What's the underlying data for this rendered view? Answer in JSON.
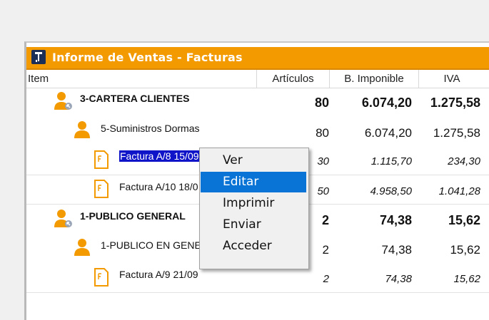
{
  "window": {
    "title": "Informe de Ventas - Facturas",
    "accent_color": "#f29a00",
    "icon": "document-pin-icon"
  },
  "columns": {
    "item": "Item",
    "articulos": "Artículos",
    "b_imponible": "B. Imponible",
    "iva": "IVA"
  },
  "rows": [
    {
      "level": 0,
      "icon": "user-group-icon",
      "label": "3-CARTERA CLIENTES",
      "articulos": "80",
      "b_imponible": "6.074,20",
      "iva": "1.275,58"
    },
    {
      "level": 1,
      "icon": "user-icon",
      "label": "5-Suministros Dormas",
      "articulos": "80",
      "b_imponible": "6.074,20",
      "iva": "1.275,58"
    },
    {
      "level": 2,
      "icon": "invoice-icon",
      "label": "Factura A/8 15/09",
      "articulos": "30",
      "b_imponible": "1.115,70",
      "iva": "234,30",
      "selected": true
    },
    {
      "level": 2,
      "icon": "invoice-icon",
      "label": "Factura A/10 18/0",
      "articulos": "50",
      "b_imponible": "4.958,50",
      "iva": "1.041,28"
    },
    {
      "level": 0,
      "icon": "user-group-icon",
      "label": "1-PUBLICO GENERAL",
      "articulos": "2",
      "b_imponible": "74,38",
      "iva": "15,62"
    },
    {
      "level": 1,
      "icon": "user-icon",
      "label": "1-PUBLICO EN GENE",
      "articulos": "2",
      "b_imponible": "74,38",
      "iva": "15,62"
    },
    {
      "level": 2,
      "icon": "invoice-icon",
      "label": "Factura A/9 21/09",
      "articulos": "2",
      "b_imponible": "74,38",
      "iva": "15,62"
    }
  ],
  "context_menu": {
    "items": [
      "Ver",
      "Editar",
      "Imprimir",
      "Enviar",
      "Acceder"
    ],
    "highlighted": "Editar",
    "highlight_color": "#0a74d6"
  },
  "selection_color": "#1014c8"
}
